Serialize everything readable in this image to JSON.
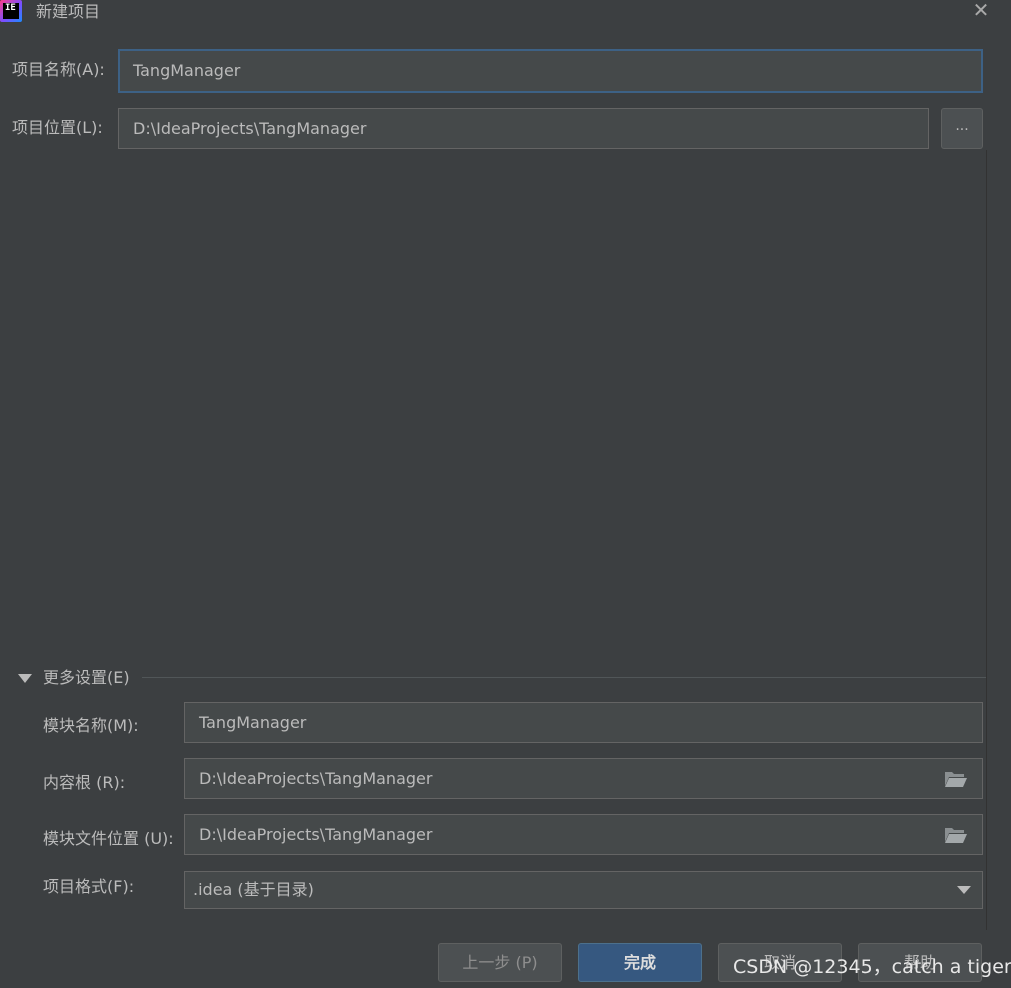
{
  "window": {
    "title": "新建项目",
    "close_glyph": "✕",
    "icon_text": "IE"
  },
  "project": {
    "name_label": "项目名称(A):",
    "name_value": "TangManager",
    "location_label": "项目位置(L):",
    "location_value": "D:\\IdeaProjects\\TangManager",
    "browse_label": "..."
  },
  "more_settings": {
    "label": "更多设置(E)",
    "expanded": true,
    "module_name_label": "模块名称(M):",
    "module_name_value": "TangManager",
    "content_root_label": "内容根 (R):",
    "content_root_value": "D:\\IdeaProjects\\TangManager",
    "module_file_label": "模块文件位置 (U):",
    "module_file_value": "D:\\IdeaProjects\\TangManager",
    "format_label": "项目格式(F):",
    "format_value": ".idea (基于目录)"
  },
  "buttons": {
    "previous": "上一步 (P)",
    "finish": "完成",
    "cancel": "取消",
    "help": "帮助"
  },
  "watermark": "CSDN @12345，catch a tiger",
  "colors": {
    "background": "#3c3f41",
    "field": "#45494a",
    "focus_border": "#3d6185",
    "primary_button": "#365880",
    "text": "#bbbbbb"
  },
  "icons": {
    "app": "intellij-idea-icon",
    "close": "close-icon",
    "folder": "folder-open-icon",
    "expand": "triangle-down-icon",
    "dropdown": "chevron-down-icon"
  }
}
